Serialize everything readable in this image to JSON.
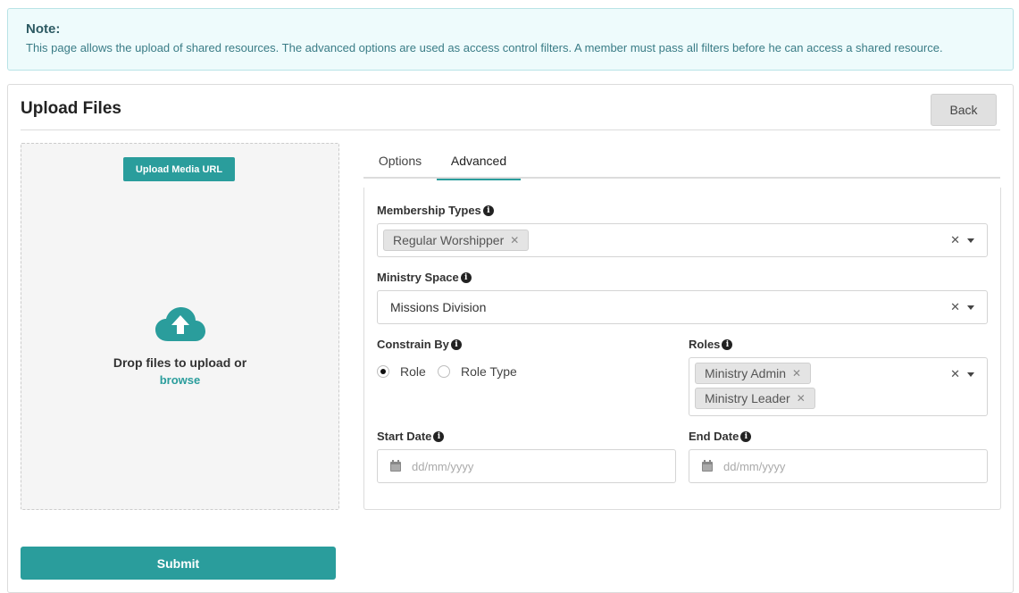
{
  "note": {
    "title": "Note:",
    "text": "This page allows the upload of shared resources. The advanced options are used as access control filters. A member must pass all filters before he can access a shared resource."
  },
  "header": {
    "title": "Upload Files",
    "back_label": "Back"
  },
  "dropzone": {
    "upload_url_label": "Upload Media URL",
    "drop_text": "Drop files to upload or",
    "browse_label": "browse"
  },
  "tabs": [
    {
      "label": "Options",
      "active": false
    },
    {
      "label": "Advanced",
      "active": true
    }
  ],
  "advanced": {
    "membership_types": {
      "label": "Membership Types",
      "chips": [
        "Regular Worshipper"
      ]
    },
    "ministry_space": {
      "label": "Ministry Space",
      "value": "Missions Division"
    },
    "constrain_by": {
      "label": "Constrain By",
      "options": [
        "Role",
        "Role Type"
      ],
      "selected": "Role"
    },
    "roles": {
      "label": "Roles",
      "chips": [
        "Ministry Admin",
        "Ministry Leader"
      ]
    },
    "start_date": {
      "label": "Start Date",
      "placeholder": "dd/mm/yyyy"
    },
    "end_date": {
      "label": "End Date",
      "placeholder": "dd/mm/yyyy"
    }
  },
  "submit_label": "Submit",
  "colors": {
    "accent": "#2a9d9c",
    "note_bg": "#eefbfc",
    "note_border": "#b9e3e6"
  },
  "icons": {
    "info": "info-circle-icon",
    "upload": "cloud-upload-icon",
    "calendar": "calendar-icon",
    "clear": "clear-x-icon",
    "dropdown": "caret-down-icon"
  }
}
